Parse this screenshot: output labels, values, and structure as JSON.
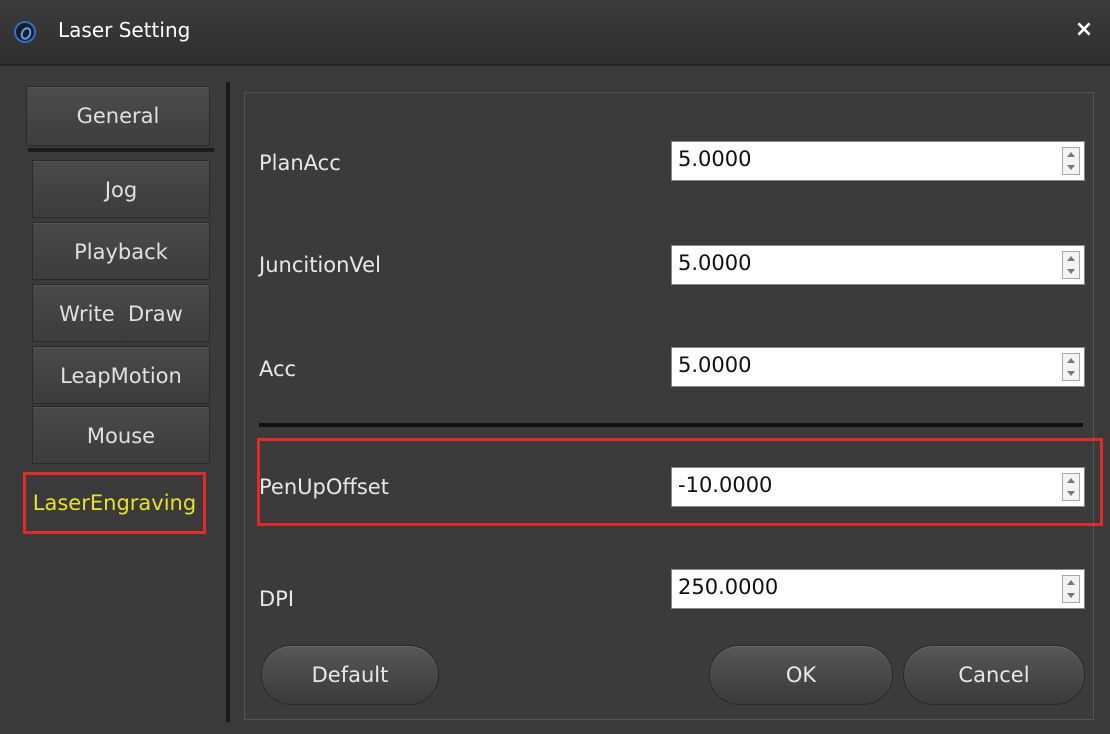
{
  "window": {
    "title": "Laser Setting",
    "close_icon": "×"
  },
  "sidebar": {
    "items": [
      {
        "label": "General"
      },
      {
        "label": "Jog"
      },
      {
        "label": "Playback"
      },
      {
        "label": "Write  Draw"
      },
      {
        "label": "LeapMotion"
      },
      {
        "label": "Mouse"
      },
      {
        "label": "LaserEngraving"
      }
    ]
  },
  "fields": [
    {
      "label": "PlanAcc",
      "value": "5.0000"
    },
    {
      "label": "JuncitionVel",
      "value": "5.0000"
    },
    {
      "label": "Acc",
      "value": "5.0000"
    },
    {
      "label": "PenUpOffset",
      "value": "-10.0000"
    },
    {
      "label": "DPI",
      "value": "250.0000"
    }
  ],
  "buttons": {
    "default": "Default",
    "ok": "OK",
    "cancel": "Cancel"
  },
  "colors": {
    "active_nav_text": "#e6e22e",
    "highlight": "#e02b2b"
  }
}
